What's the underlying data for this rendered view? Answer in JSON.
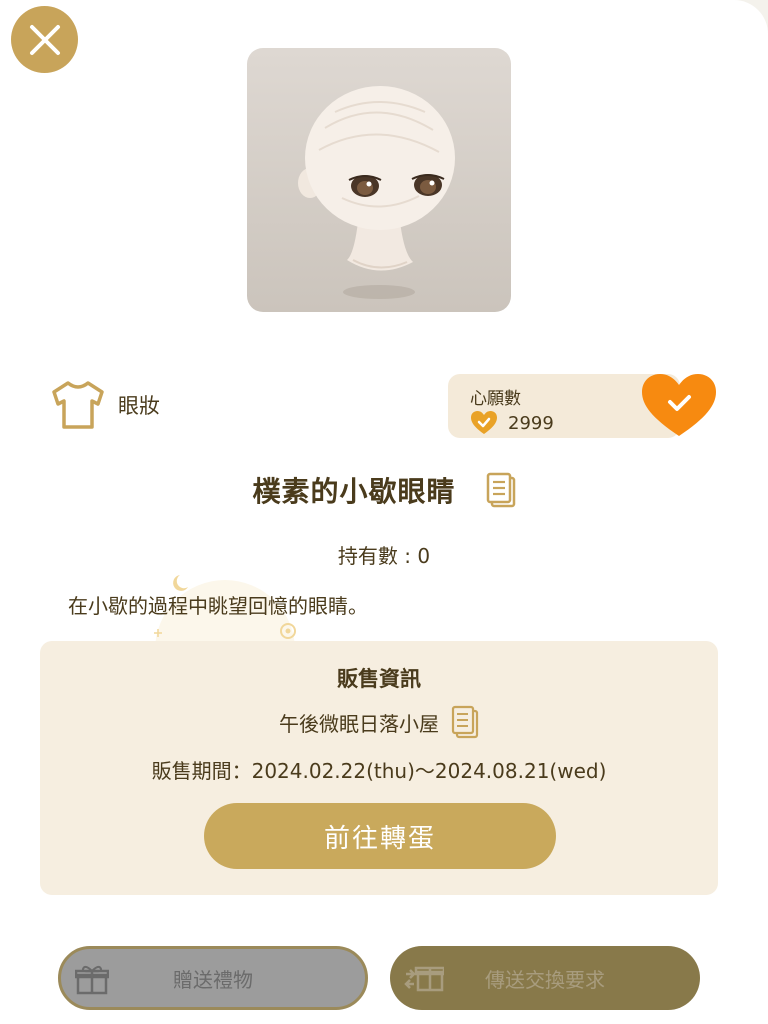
{
  "item": {
    "category": "眼妝",
    "name": "樸素的小歇眼睛",
    "owned_text": "持有數 : 0",
    "description": "在小歇的過程中眺望回憶的眼睛。"
  },
  "wishlist": {
    "title": "心願數",
    "count": "2999"
  },
  "sale": {
    "title": "販售資訊",
    "shop": "午後微眠日落小屋",
    "period": "販售期間：2024.02.22(thu)～2024.08.21(wed)",
    "goto_label": "前往轉蛋"
  },
  "actions": {
    "gift_label": "贈送禮物",
    "trade_label": "傳送交換要求"
  },
  "colors": {
    "accent_gold": "#c8a45a",
    "heart_orange": "#f78a10",
    "text_brown": "#4a3b1c"
  },
  "icons": [
    "close-icon",
    "shirt-icon",
    "heart-check-icon",
    "copy-icon",
    "gift-icon",
    "trade-icon"
  ]
}
